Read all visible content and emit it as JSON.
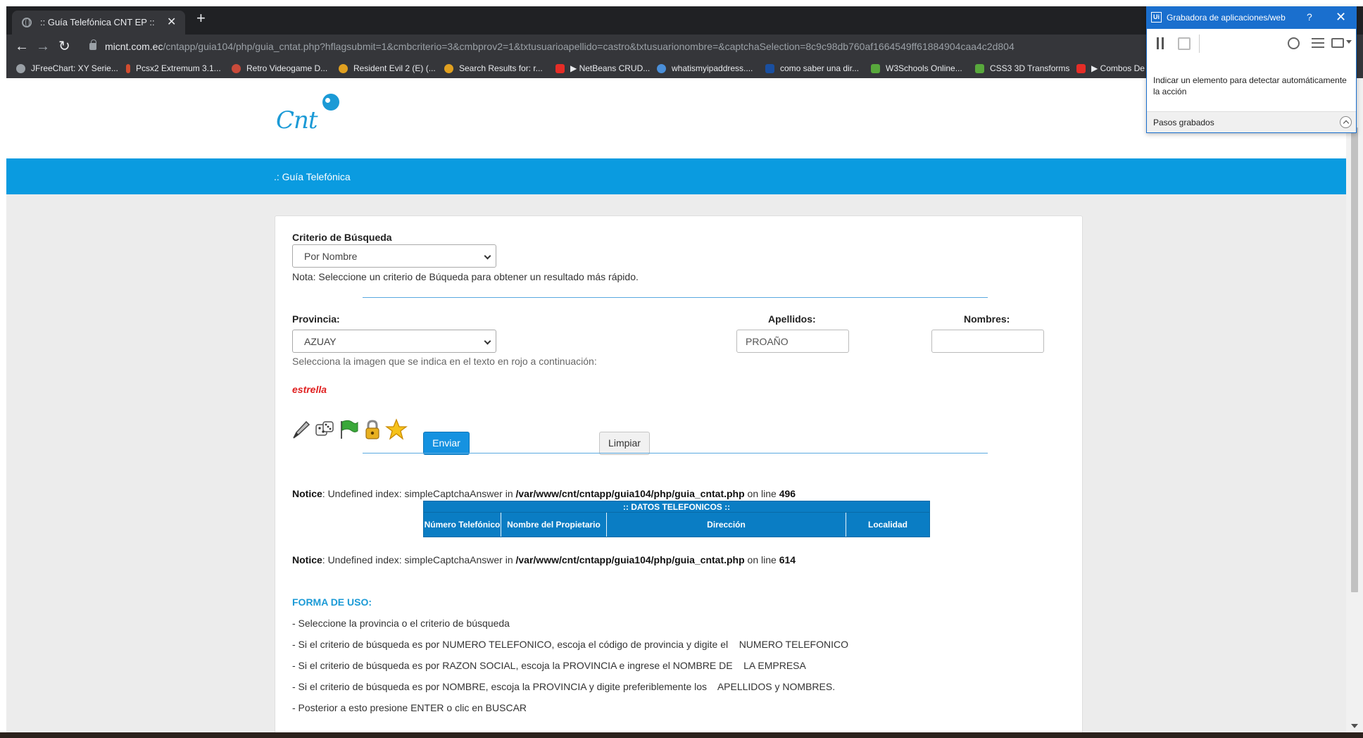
{
  "browser": {
    "tab_title": ":: Guía Telefónica CNT EP ::",
    "url_host": "micnt.com.ec",
    "url_path": "/cntapp/guia104/php/guia_cntat.php?hflagsubmit=1&cmbcriterio=3&cmbprov2=1&txtusuarioapellido=castro&txtusuarionombre=&captchaSelection=8c9c98db760af1664549ff61884904caa4c2d804",
    "bookmarks": [
      {
        "label": "JFreeChart: XY Serie...",
        "color": "#9aa0a6"
      },
      {
        "label": "Pcsx2 Extremum 3.1...",
        "color": "#d24c2f"
      },
      {
        "label": "Retro Videogame D...",
        "color": "#c94a3a"
      },
      {
        "label": "Resident Evil 2 (E) (...",
        "color": "#e0a020"
      },
      {
        "label": "Search Results for: r...",
        "color": "#e0a020"
      },
      {
        "label": "▶ NetBeans CRUD...",
        "color": "#e52d27"
      },
      {
        "label": "whatismyipaddress....",
        "color": "#4a8fd9"
      },
      {
        "label": "como saber una dir...",
        "color": "#1a4fa0"
      },
      {
        "label": "W3Schools Online...",
        "color": "#58a83c"
      },
      {
        "label": "CSS3 3D Transforms",
        "color": "#58a83c"
      },
      {
        "label": "▶ Combos De",
        "color": "#e52d27"
      }
    ]
  },
  "recorder": {
    "title": "Grabadora de aplicaciones/web",
    "help": "?",
    "close": "✕",
    "logo": "Ui",
    "instruction": "Indicar un elemento para detectar automáticamente la acción",
    "steps_label": "Pasos grabados"
  },
  "page": {
    "logo_text": "Cnt",
    "band_title": ".: Guía Telefónica",
    "criterio_label": "Criterio de Búsqueda",
    "criterio_value": "Por Nombre",
    "criterio_note": "Nota: Seleccione un criterio de Búqueda para obtener un resultado más rápido.",
    "provincia_label": "Provincia:",
    "provincia_value": "AZUAY",
    "apellidos_label": "Apellidos:",
    "apellidos_value": "PROAÑO",
    "nombres_label": "Nombres:",
    "nombres_value": "",
    "captcha_instruction": "Selecciona la imagen que se indica en el texto en rojo a continuación:",
    "captcha_word": "estrella",
    "captcha_icons": [
      "pencil-icon",
      "dice-icon",
      "flag-icon",
      "padlock-icon",
      "star-icon"
    ],
    "enviar_label": "Enviar",
    "limpiar_label": "Limpiar",
    "notice1": {
      "label": "Notice",
      "text": ": Undefined index: simpleCaptchaAnswer in ",
      "path": "/var/www/cnt/cntapp/guia104/php/guia_cntat.php",
      "on_line": " on line ",
      "line": "496"
    },
    "table": {
      "caption": ":: DATOS TELEFONICOS ::",
      "headers": [
        "Número Telefónico",
        "Nombre del Propietario",
        "Dirección",
        "Localidad"
      ]
    },
    "notice2": {
      "label": "Notice",
      "text": ": Undefined index: simpleCaptchaAnswer in ",
      "path": "/var/www/cnt/cntapp/guia104/php/guia_cntat.php",
      "on_line": " on line ",
      "line": "614"
    },
    "usage_title": "FORMA DE USO:",
    "usage_lines": [
      "- Seleccione la provincia o el criterio de búsqueda",
      "- Si el criterio de búsqueda es por NUMERO TELEFONICO, escoja el código de provincia y digite el    NUMERO TELEFONICO",
      "- Si el criterio de búsqueda es por RAZON SOCIAL, escoja la PROVINCIA e ingrese el NOMBRE DE    LA EMPRESA",
      "- Si el criterio de búsqueda es por NOMBRE, escoja la PROVINCIA y digite preferiblemente los    APELLIDOS y NOMBRES.",
      "- Posterior a esto presione ENTER o clic en BUSCAR"
    ]
  },
  "colors": {
    "brand_blue": "#0a9be0",
    "captcha_red": "#e02020",
    "table_blue": "#0a7dc4"
  }
}
